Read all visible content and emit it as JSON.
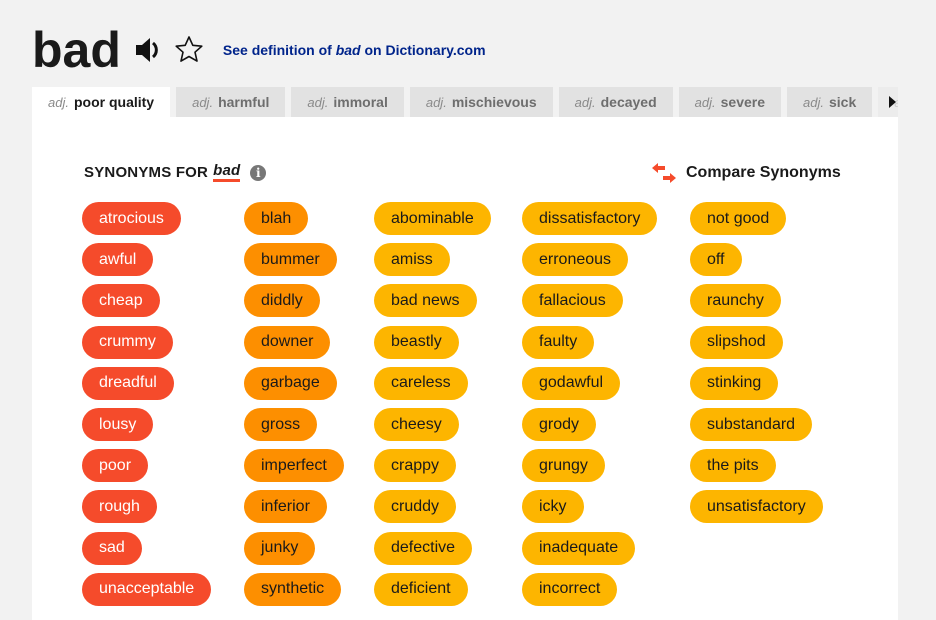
{
  "header": {
    "word": "bad",
    "speaker_icon": "speaker-icon",
    "favorite_icon": "star-icon",
    "definition_link": {
      "prefix": "See definition of ",
      "word": "bad",
      "suffix": " on Dictionary.com"
    }
  },
  "tabs": [
    {
      "pos": "adj.",
      "label": "poor quality",
      "active": true
    },
    {
      "pos": "adj.",
      "label": "harmful"
    },
    {
      "pos": "adj.",
      "label": "immoral"
    },
    {
      "pos": "adj.",
      "label": "mischievous"
    },
    {
      "pos": "adj.",
      "label": "decayed"
    },
    {
      "pos": "adj.",
      "label": "severe"
    },
    {
      "pos": "adj.",
      "label": "sick"
    },
    {
      "pos": "adj.",
      "label": "s"
    }
  ],
  "synonyms_title": {
    "prefix": "SYNONYMS FOR",
    "word": "bad"
  },
  "compare_label": "Compare Synonyms",
  "colors": {
    "most_relevant": "#f54b2b",
    "relevant": "#fd8f00",
    "less_relevant": "#fdb500",
    "link": "#00248b"
  },
  "columns": [
    [
      "atrocious",
      "awful",
      "cheap",
      "crummy",
      "dreadful",
      "lousy",
      "poor",
      "rough",
      "sad",
      "unacceptable"
    ],
    [
      "blah",
      "bummer",
      "diddly",
      "downer",
      "garbage",
      "gross",
      "imperfect",
      "inferior",
      "junky",
      "synthetic"
    ],
    [
      "abominable",
      "amiss",
      "bad news",
      "beastly",
      "careless",
      "cheesy",
      "crappy",
      "cruddy",
      "defective",
      "deficient"
    ],
    [
      "dissatisfactory",
      "erroneous",
      "fallacious",
      "faulty",
      "godawful",
      "grody",
      "grungy",
      "icky",
      "inadequate",
      "incorrect"
    ],
    [
      "not good",
      "off",
      "raunchy",
      "slipshod",
      "stinking",
      "substandard",
      "the pits",
      "unsatisfactory"
    ]
  ]
}
